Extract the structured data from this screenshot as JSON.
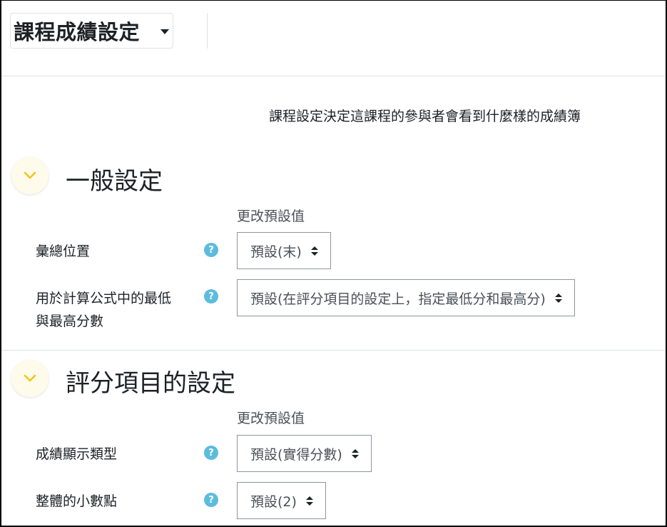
{
  "header": {
    "page_selector_label": "課程成績設定"
  },
  "intro_text": "課程設定決定這課程的參與者會看到什麼樣的成績簿",
  "sections": {
    "general": {
      "title": "一般設定",
      "column_header": "更改預設值",
      "fields": {
        "aggregation_position": {
          "label": "彙總位置",
          "value": "預設(末)"
        },
        "min_max": {
          "label_line1": "用於計算公式中的最低",
          "label_line2": "與最高分數",
          "value": "預設(在評分項目的設定上，指定最低分和最高分)"
        }
      }
    },
    "grade_item": {
      "title": "評分項目的設定",
      "column_header": "更改預設值",
      "fields": {
        "display_type": {
          "label": "成績顯示類型",
          "value": "預設(實得分數)"
        },
        "decimal_points": {
          "label": "整體的小數點",
          "value": "預設(2)"
        }
      }
    }
  },
  "help_icon_text": "?",
  "icons": {
    "toggle": "chevron-down-icon",
    "help": "help-icon",
    "select": "sort-arrows-icon",
    "caret": "caret-down-icon"
  },
  "colors": {
    "help": "#5cbcde",
    "toggle_bg": "#fffbea",
    "chevron": "#f0c419"
  }
}
